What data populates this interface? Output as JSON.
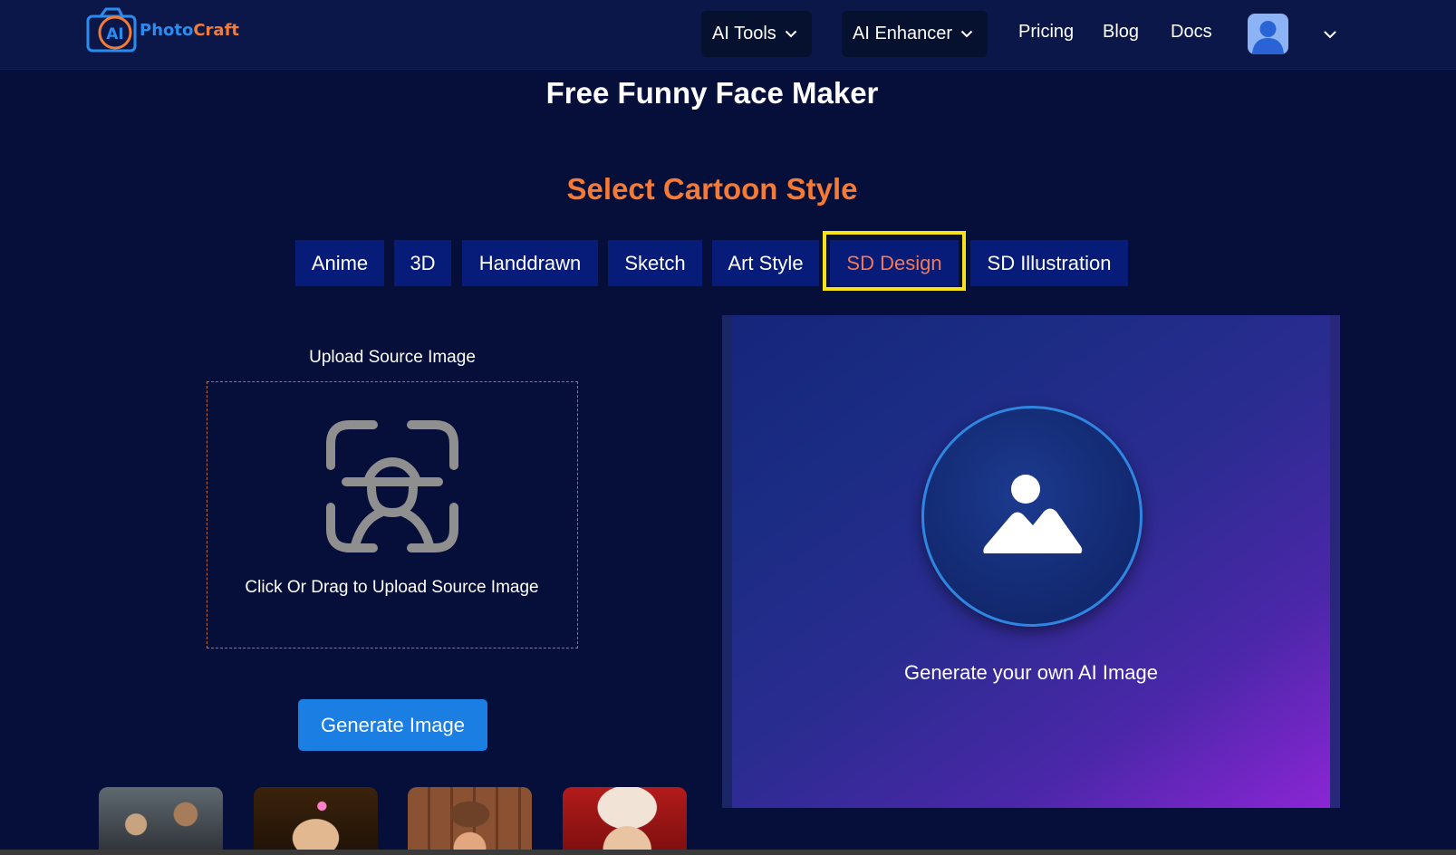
{
  "brand": {
    "logo_mark": "AI",
    "name_part1": "Photo",
    "name_part2": "Craft"
  },
  "nav": {
    "ai_tools": "AI Tools",
    "ai_enhancer": "AI Enhancer",
    "pricing": "Pricing",
    "blog": "Blog",
    "docs": "Docs"
  },
  "page_title": "Free Funny Face Maker",
  "style_section": {
    "title": "Select Cartoon Style",
    "tabs": [
      "Anime",
      "3D",
      "Handdrawn",
      "Sketch",
      "Art Style",
      "SD Design",
      "SD Illustration"
    ],
    "selected": "SD Design"
  },
  "upload": {
    "label": "Upload Source Image",
    "drop_text": "Click Or Drag to Upload Source Image",
    "icon": "face-scan-icon"
  },
  "generate_button": "Generate Image",
  "result": {
    "text": "Generate your own AI Image",
    "icon": "image-icon"
  },
  "colors": {
    "background": "#060f3a",
    "header": "#0a1748",
    "accent_orange": "#f47a35",
    "tab_bg": "#071b78",
    "highlight": "#f7e21a",
    "button_blue": "#1b7ee3"
  }
}
